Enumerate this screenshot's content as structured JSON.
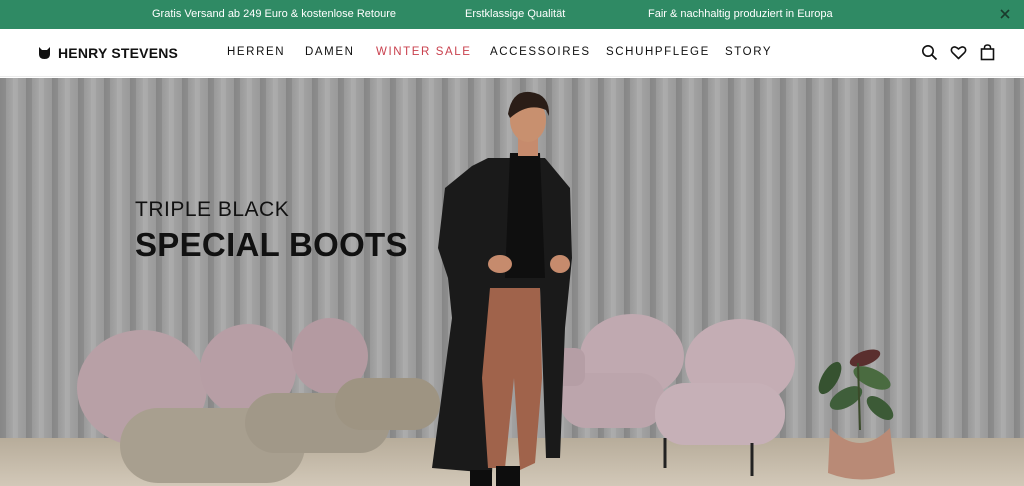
{
  "announcement": {
    "messages": [
      "Gratis Versand ab 249 Euro & kostenlose Retoure",
      "Erstklassige Qualität",
      "Fair & nachhaltig produziert in Europa"
    ],
    "background": "#2f8a64"
  },
  "header": {
    "logo_text": "HENRY STEVENS",
    "nav": [
      "HERREN",
      "DAMEN",
      "WINTER SALE",
      "ACCESSOIRES",
      "SCHUHPFLEGE",
      "STORY"
    ],
    "sale_color": "#c9414e",
    "icons": [
      "search-icon",
      "heart-icon",
      "bag-icon"
    ]
  },
  "hero": {
    "subtitle": "TRIPLE BLACK",
    "title": "SPECIAL BOOTS"
  }
}
